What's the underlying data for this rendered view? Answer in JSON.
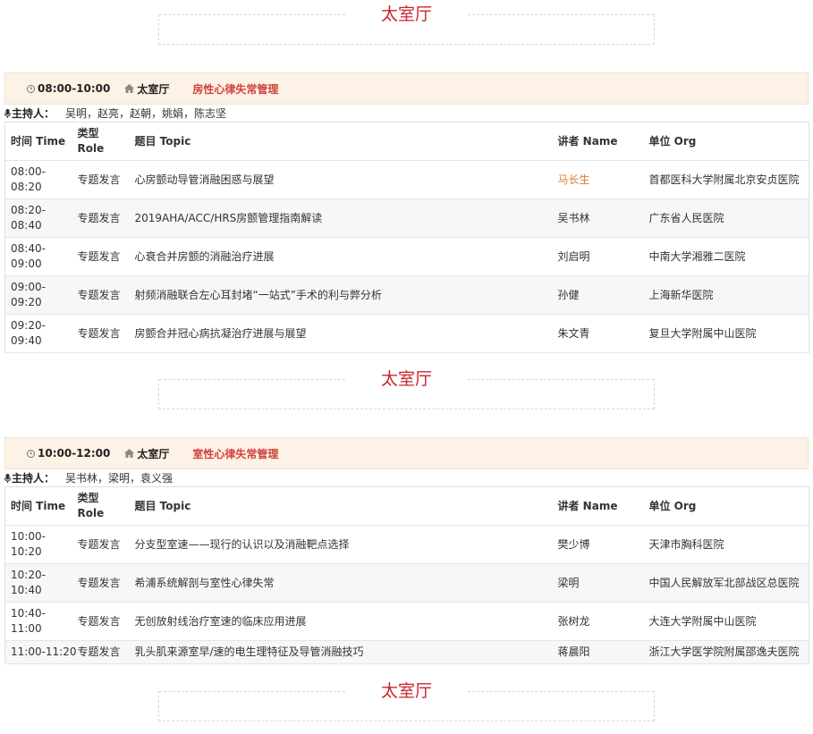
{
  "hall_name": "太室厅",
  "table_headers": {
    "time": "时间 Time",
    "role": "类型 Role",
    "topic": "题目 Topic",
    "speaker": "讲者 Name",
    "org": "单位 Org"
  },
  "host_label": "主持人：",
  "sessions": [
    {
      "time": "08:00-10:00",
      "room": "太室厅",
      "topic": "房性心律失常管理",
      "hosts": "吴明，赵亮，赵朝，姚娟，陈志坚",
      "rows": [
        {
          "time": "08:00-08:20",
          "role": "专题发言",
          "topic": "心房颤动导管消融困惑与展望",
          "speaker": "马长生",
          "org": "首都医科大学附属北京安贞医院"
        },
        {
          "time": "08:20-08:40",
          "role": "专题发言",
          "topic": "2019AHA/ACC/HRS房颤管理指南解读",
          "speaker": "吴书林",
          "org": "广东省人民医院"
        },
        {
          "time": "08:40-09:00",
          "role": "专题发言",
          "topic": "心衰合并房颤的消融治疗进展",
          "speaker": "刘启明",
          "org": "中南大学湘雅二医院"
        },
        {
          "time": "09:00-09:20",
          "role": "专题发言",
          "topic": "射频消融联合左心耳封堵“一站式”手术的利与弊分析",
          "speaker": "孙健",
          "org": "上海新华医院"
        },
        {
          "time": "09:20-09:40",
          "role": "专题发言",
          "topic": "房颤合并冠心病抗凝治疗进展与展望",
          "speaker": "朱文青",
          "org": "复旦大学附属中山医院"
        }
      ]
    },
    {
      "time": "10:00-12:00",
      "room": "太室厅",
      "topic": "室性心律失常管理",
      "hosts": "吴书林，梁明，袁义强",
      "rows": [
        {
          "time": "10:00-10:20",
          "role": "专题发言",
          "topic": "分支型室速——现行的认识以及消融靶点选择",
          "speaker": "樊少博",
          "org": "天津市胸科医院"
        },
        {
          "time": "10:20-10:40",
          "role": "专题发言",
          "topic": "希浦系统解剖与室性心律失常",
          "speaker": "梁明",
          "org": "中国人民解放军北部战区总医院"
        },
        {
          "time": "10:40-11:00",
          "role": "专题发言",
          "topic": "无创放射线治疗室速的临床应用进展",
          "speaker": "张树龙",
          "org": "大连大学附属中山医院"
        },
        {
          "time": "11:00-11:20",
          "role": "专题发言",
          "topic": "乳头肌来源室早/速的电生理特征及导管消融技巧",
          "speaker": "蒋晨阳",
          "org": "浙江大学医学院附属邵逸夫医院"
        }
      ]
    }
  ],
  "colors": {
    "hall_title": "#c9252b",
    "session_topic": "#d0423b",
    "speaker_highlight": "#e07b31",
    "session_header_bg": "#fdf2e6"
  },
  "icons": {
    "time": "clock-icon",
    "room": "home-icon",
    "host": "microphone-icon"
  }
}
